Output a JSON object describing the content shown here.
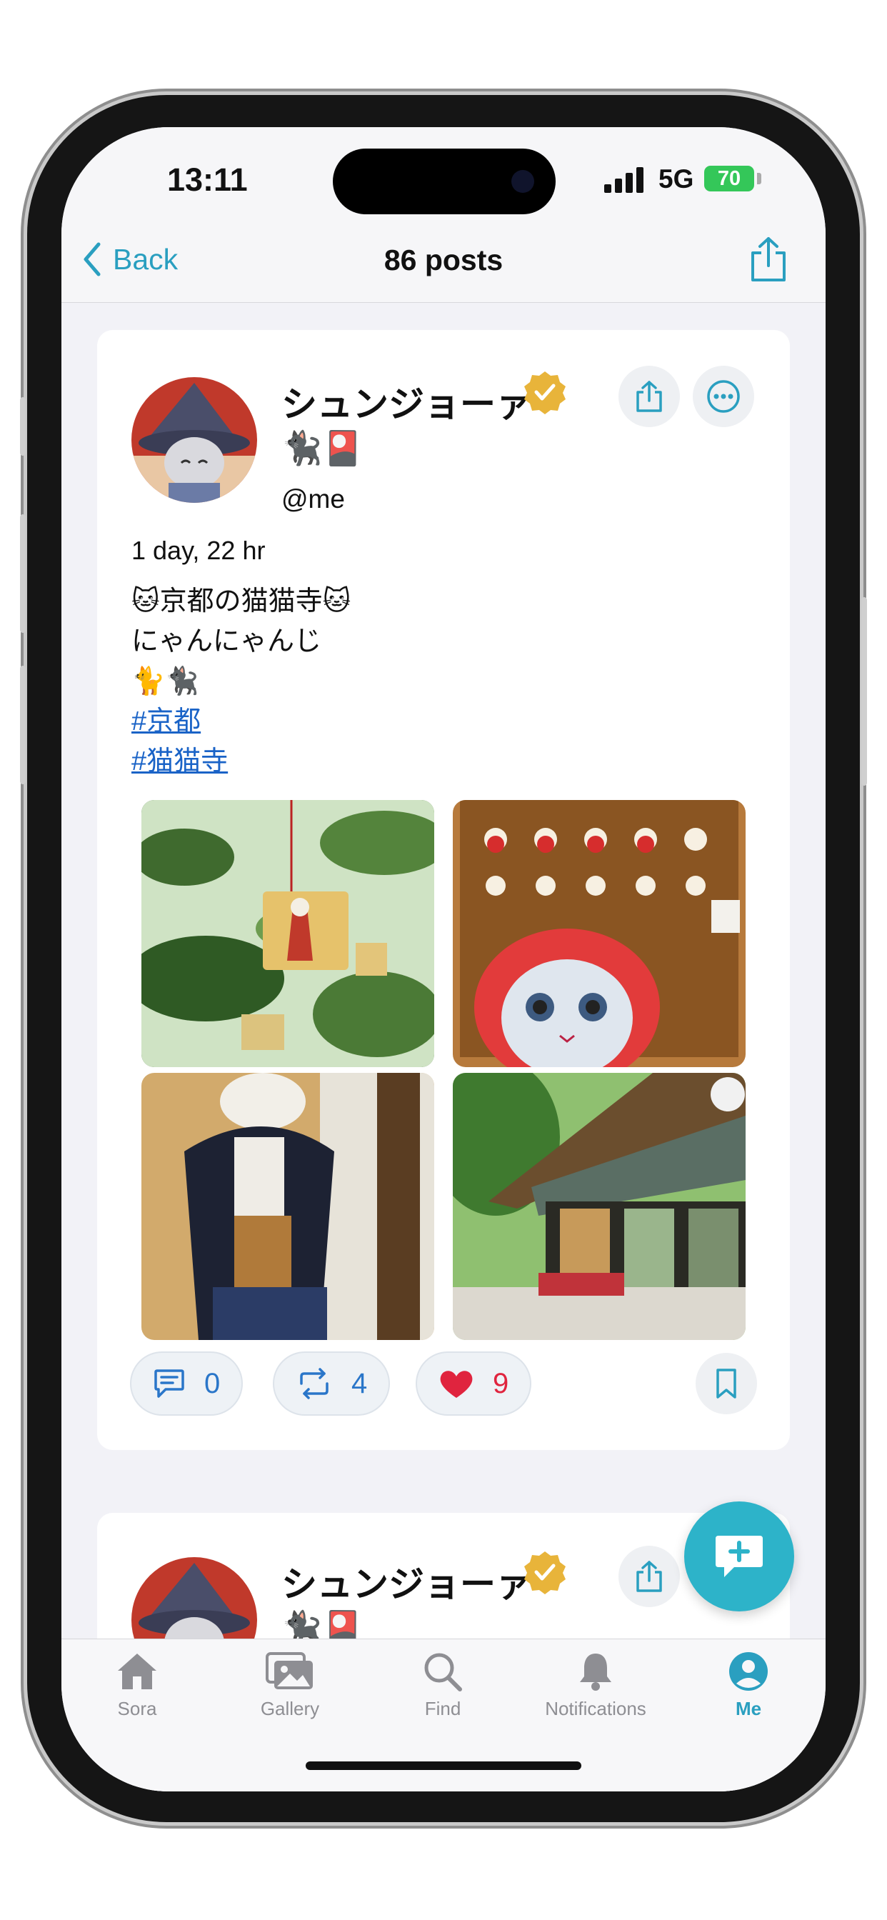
{
  "status": {
    "time": "13:11",
    "network": "5G",
    "battery": "70"
  },
  "nav": {
    "back_label": "Back",
    "title": "86 posts"
  },
  "post": {
    "username": "シュンジョーァ",
    "emojis": "🐈‍⬛🎴",
    "handle": "@me",
    "timestamp": "1 day, 22 hr",
    "lines": [
      "🐱京都の猫猫寺🐱",
      "にゃんにゃんじ",
      "🐈🐈‍⬛"
    ],
    "tags": [
      "#京都",
      "#猫猫寺"
    ],
    "reply_count": "0",
    "repost_count": "4",
    "like_count": "9"
  },
  "post2": {
    "username": "シュンジョーァ",
    "emojis": "🐈‍⬛🎴"
  },
  "tabs": [
    {
      "label": "Sora",
      "icon": "house-icon"
    },
    {
      "label": "Gallery",
      "icon": "photos-icon"
    },
    {
      "label": "Find",
      "icon": "magnifier-icon"
    },
    {
      "label": "Notifications",
      "icon": "bell-icon"
    },
    {
      "label": "Me",
      "icon": "person-circle-icon"
    }
  ],
  "colors": {
    "accent": "#2a9fc0",
    "link": "#1a63c7",
    "like": "#e0243e",
    "fab": "#2db3c9"
  }
}
